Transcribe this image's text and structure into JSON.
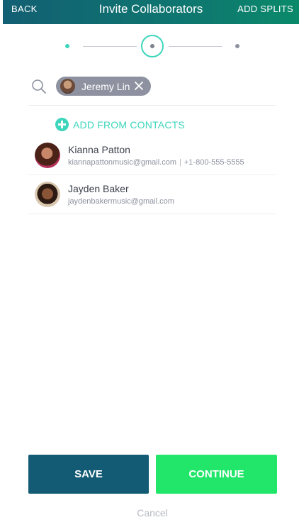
{
  "header": {
    "back_label": "BACK",
    "title": "Invite Collaborators",
    "add_splits_label": "ADD SPLITS"
  },
  "stepper": {
    "total_steps": 3,
    "current_step": 2
  },
  "search": {
    "icon": "search-icon",
    "selected_chips": [
      {
        "name": "Jeremy Lin",
        "remove_icon": "close-icon"
      }
    ]
  },
  "add_from_contacts": {
    "icon": "plus-circle-icon",
    "label": "ADD FROM CONTACTS"
  },
  "contacts": [
    {
      "name": "Kianna Patton",
      "email": "kiannapattonmusic@gmail.com",
      "separator": "|",
      "phone": "+1-800-555-5555"
    },
    {
      "name": "Jayden Baker",
      "email": "jaydenbakermusic@gmail.com"
    }
  ],
  "actions": {
    "save_label": "SAVE",
    "continue_label": "CONTINUE",
    "cancel_label": "Cancel"
  },
  "colors": {
    "accent": "#3dd6bc",
    "save_button": "#135b74",
    "continue_button": "#22e66a",
    "chip": "#8e92a0"
  }
}
